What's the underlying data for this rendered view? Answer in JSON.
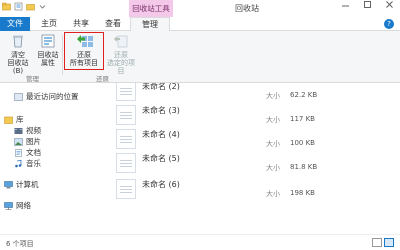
{
  "window": {
    "title": "回收站",
    "context_tool_title": "回收站工具"
  },
  "tabs": {
    "file": "文件",
    "home": "主页",
    "share": "共享",
    "view": "查看",
    "manage": "管理"
  },
  "ribbon": {
    "empty_recycle_bin": {
      "line1": "清空",
      "line2": "回收站(B)"
    },
    "recycle_bin_props": {
      "line1": "回收站",
      "line2": "属性"
    },
    "restore_all": {
      "line1": "还原",
      "line2": "所有项目"
    },
    "restore_selected": {
      "line1": "还原",
      "line2": "选定的项目"
    },
    "group_manage": "管理",
    "group_restore": "还原"
  },
  "nav": {
    "recent": "最近访问的位置",
    "libraries": "库",
    "videos": "视频",
    "pictures": "图片",
    "documents": "文档",
    "music": "音乐",
    "computer": "计算机",
    "network": "网络"
  },
  "files": [
    {
      "name": "未命名 (2)",
      "size_label": "大小",
      "size": "62.2 KB"
    },
    {
      "name": "未命名 (3)",
      "size_label": "大小",
      "size": "117 KB"
    },
    {
      "name": "未命名 (4)",
      "size_label": "大小",
      "size": "100 KB"
    },
    {
      "name": "未命名 (5)",
      "size_label": "大小",
      "size": "81.8 KB"
    },
    {
      "name": "未命名 (6)",
      "size_label": "大小",
      "size": "198 KB"
    }
  ],
  "status": {
    "item_count": "6 个项目"
  },
  "colors": {
    "accent": "#1979ca",
    "context_tab": "#f3c8e8",
    "highlight_border": "#e02020"
  }
}
